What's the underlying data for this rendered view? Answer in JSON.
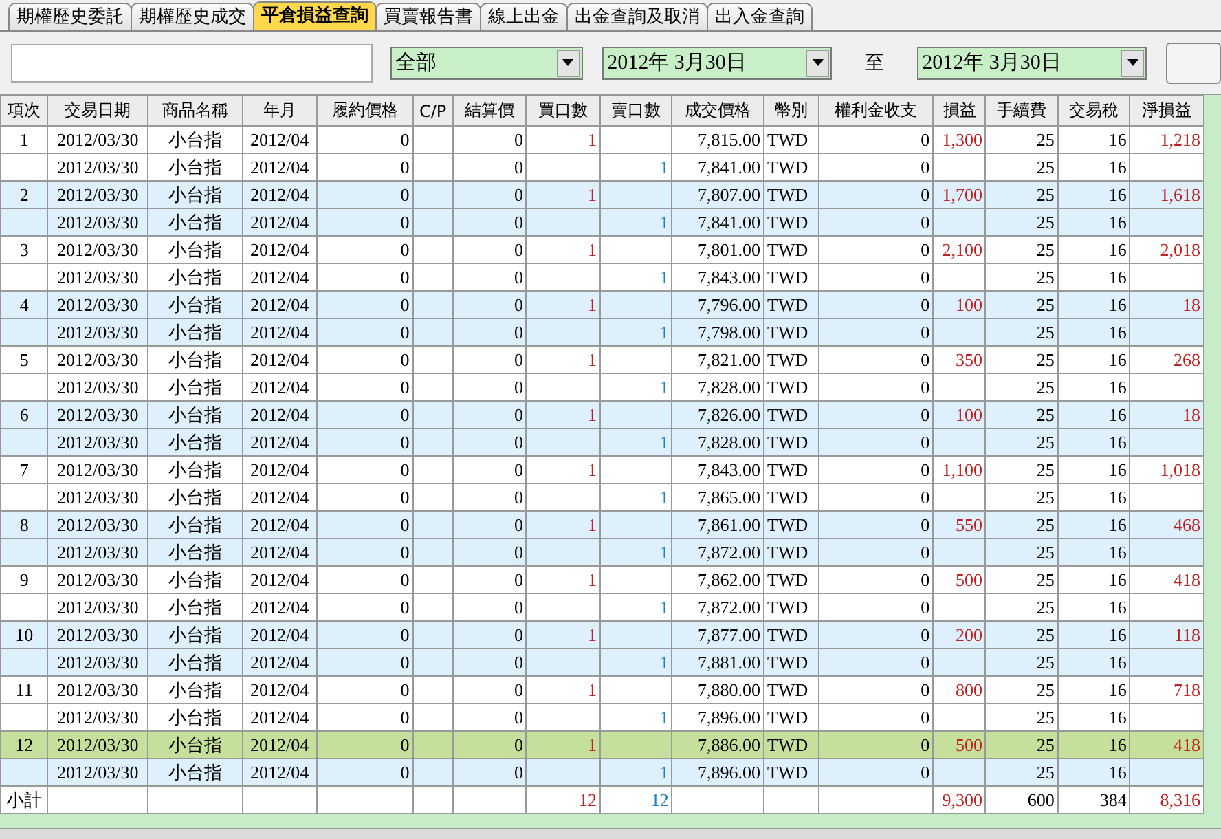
{
  "tabs": [
    {
      "label": "期權歷史委託",
      "selected": false
    },
    {
      "label": "期權歷史成交",
      "selected": false
    },
    {
      "label": "平倉損益查詢",
      "selected": true
    },
    {
      "label": "買賣報告書",
      "selected": false
    },
    {
      "label": "線上出金",
      "selected": false
    },
    {
      "label": "出金查詢及取消",
      "selected": false
    },
    {
      "label": "出入金查詢",
      "selected": false
    }
  ],
  "filter": {
    "category": "全部",
    "date_from": "2012年  3月30日",
    "separator": "至",
    "date_to": "2012年  3月30日"
  },
  "table": {
    "columns": [
      "項次",
      "交易日期",
      "商品名稱",
      "年月",
      "履約價格",
      "C/P",
      "結算價",
      "買口數",
      "賣口數",
      "成交價格",
      "幣別",
      "權利金收支",
      "損益",
      "手續費",
      "交易稅",
      "淨損益"
    ],
    "rows": [
      {
        "selected": false,
        "cells": [
          "1",
          "2012/03/30",
          "小台指",
          "2012/04",
          "0",
          null,
          "0",
          "1",
          null,
          "7,815.00",
          "TWD",
          "0",
          "1,300",
          "25",
          "16",
          "1,218"
        ]
      },
      {
        "selected": false,
        "cells": [
          null,
          "2012/03/30",
          "小台指",
          "2012/04",
          "0",
          null,
          "0",
          null,
          "1",
          "7,841.00",
          "TWD",
          "0",
          null,
          "25",
          "16",
          null
        ]
      },
      {
        "selected": false,
        "cells": [
          "2",
          "2012/03/30",
          "小台指",
          "2012/04",
          "0",
          null,
          "0",
          "1",
          null,
          "7,807.00",
          "TWD",
          "0",
          "1,700",
          "25",
          "16",
          "1,618"
        ]
      },
      {
        "selected": false,
        "cells": [
          null,
          "2012/03/30",
          "小台指",
          "2012/04",
          "0",
          null,
          "0",
          null,
          "1",
          "7,841.00",
          "TWD",
          "0",
          null,
          "25",
          "16",
          null
        ]
      },
      {
        "selected": false,
        "cells": [
          "3",
          "2012/03/30",
          "小台指",
          "2012/04",
          "0",
          null,
          "0",
          "1",
          null,
          "7,801.00",
          "TWD",
          "0",
          "2,100",
          "25",
          "16",
          "2,018"
        ]
      },
      {
        "selected": false,
        "cells": [
          null,
          "2012/03/30",
          "小台指",
          "2012/04",
          "0",
          null,
          "0",
          null,
          "1",
          "7,843.00",
          "TWD",
          "0",
          null,
          "25",
          "16",
          null
        ]
      },
      {
        "selected": false,
        "cells": [
          "4",
          "2012/03/30",
          "小台指",
          "2012/04",
          "0",
          null,
          "0",
          "1",
          null,
          "7,796.00",
          "TWD",
          "0",
          "100",
          "25",
          "16",
          "18"
        ]
      },
      {
        "selected": false,
        "cells": [
          null,
          "2012/03/30",
          "小台指",
          "2012/04",
          "0",
          null,
          "0",
          null,
          "1",
          "7,798.00",
          "TWD",
          "0",
          null,
          "25",
          "16",
          null
        ]
      },
      {
        "selected": false,
        "cells": [
          "5",
          "2012/03/30",
          "小台指",
          "2012/04",
          "0",
          null,
          "0",
          "1",
          null,
          "7,821.00",
          "TWD",
          "0",
          "350",
          "25",
          "16",
          "268"
        ]
      },
      {
        "selected": false,
        "cells": [
          null,
          "2012/03/30",
          "小台指",
          "2012/04",
          "0",
          null,
          "0",
          null,
          "1",
          "7,828.00",
          "TWD",
          "0",
          null,
          "25",
          "16",
          null
        ]
      },
      {
        "selected": false,
        "cells": [
          "6",
          "2012/03/30",
          "小台指",
          "2012/04",
          "0",
          null,
          "0",
          "1",
          null,
          "7,826.00",
          "TWD",
          "0",
          "100",
          "25",
          "16",
          "18"
        ]
      },
      {
        "selected": false,
        "cells": [
          null,
          "2012/03/30",
          "小台指",
          "2012/04",
          "0",
          null,
          "0",
          null,
          "1",
          "7,828.00",
          "TWD",
          "0",
          null,
          "25",
          "16",
          null
        ]
      },
      {
        "selected": false,
        "cells": [
          "7",
          "2012/03/30",
          "小台指",
          "2012/04",
          "0",
          null,
          "0",
          "1",
          null,
          "7,843.00",
          "TWD",
          "0",
          "1,100",
          "25",
          "16",
          "1,018"
        ]
      },
      {
        "selected": false,
        "cells": [
          null,
          "2012/03/30",
          "小台指",
          "2012/04",
          "0",
          null,
          "0",
          null,
          "1",
          "7,865.00",
          "TWD",
          "0",
          null,
          "25",
          "16",
          null
        ]
      },
      {
        "selected": false,
        "cells": [
          "8",
          "2012/03/30",
          "小台指",
          "2012/04",
          "0",
          null,
          "0",
          "1",
          null,
          "7,861.00",
          "TWD",
          "0",
          "550",
          "25",
          "16",
          "468"
        ]
      },
      {
        "selected": false,
        "cells": [
          null,
          "2012/03/30",
          "小台指",
          "2012/04",
          "0",
          null,
          "0",
          null,
          "1",
          "7,872.00",
          "TWD",
          "0",
          null,
          "25",
          "16",
          null
        ]
      },
      {
        "selected": false,
        "cells": [
          "9",
          "2012/03/30",
          "小台指",
          "2012/04",
          "0",
          null,
          "0",
          "1",
          null,
          "7,862.00",
          "TWD",
          "0",
          "500",
          "25",
          "16",
          "418"
        ]
      },
      {
        "selected": false,
        "cells": [
          null,
          "2012/03/30",
          "小台指",
          "2012/04",
          "0",
          null,
          "0",
          null,
          "1",
          "7,872.00",
          "TWD",
          "0",
          null,
          "25",
          "16",
          null
        ]
      },
      {
        "selected": false,
        "cells": [
          "10",
          "2012/03/30",
          "小台指",
          "2012/04",
          "0",
          null,
          "0",
          "1",
          null,
          "7,877.00",
          "TWD",
          "0",
          "200",
          "25",
          "16",
          "118"
        ]
      },
      {
        "selected": false,
        "cells": [
          null,
          "2012/03/30",
          "小台指",
          "2012/04",
          "0",
          null,
          "0",
          null,
          "1",
          "7,881.00",
          "TWD",
          "0",
          null,
          "25",
          "16",
          null
        ]
      },
      {
        "selected": false,
        "cells": [
          "11",
          "2012/03/30",
          "小台指",
          "2012/04",
          "0",
          null,
          "0",
          "1",
          null,
          "7,880.00",
          "TWD",
          "0",
          "800",
          "25",
          "16",
          "718"
        ]
      },
      {
        "selected": false,
        "cells": [
          null,
          "2012/03/30",
          "小台指",
          "2012/04",
          "0",
          null,
          "0",
          null,
          "1",
          "7,896.00",
          "TWD",
          "0",
          null,
          "25",
          "16",
          null
        ]
      },
      {
        "selected": true,
        "cells": [
          "12",
          "2012/03/30",
          "小台指",
          "2012/04",
          "0",
          null,
          "0",
          "1",
          null,
          "7,886.00",
          "TWD",
          "0",
          "500",
          "25",
          "16",
          "418"
        ]
      },
      {
        "selected": false,
        "cells": [
          null,
          "2012/03/30",
          "小台指",
          "2012/04",
          "0",
          null,
          "0",
          null,
          "1",
          "7,896.00",
          "TWD",
          "0",
          null,
          "25",
          "16",
          null
        ]
      }
    ],
    "subtotal": {
      "label": "小計",
      "buy_qty": "12",
      "sell_qty": "12",
      "profit": "9,300",
      "fee": "600",
      "tax": "384",
      "net_profit": "8,316"
    }
  }
}
